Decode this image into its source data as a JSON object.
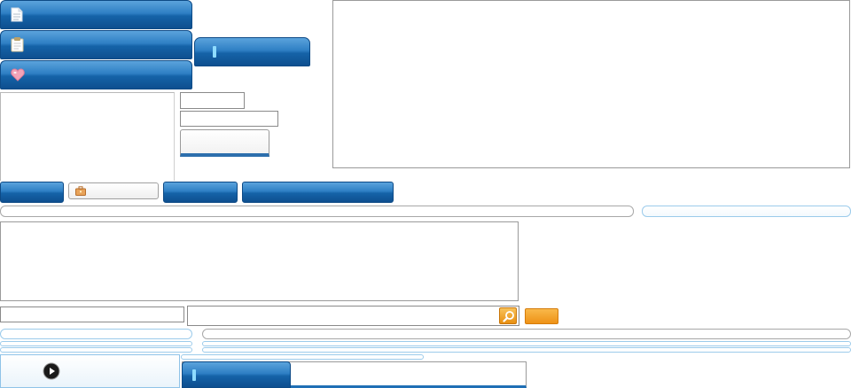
{
  "menu": {
    "items": [
      {
        "icon": "document-icon",
        "label": ""
      },
      {
        "icon": "clipboard-icon",
        "label": ""
      },
      {
        "icon": "heart-icon",
        "label": ""
      }
    ]
  },
  "side_tab": {
    "label": ""
  },
  "form": {
    "field_small_value": "",
    "field_medium_value": "",
    "button_label": ""
  },
  "toolbar": {
    "btn1_label": "",
    "briefcase_btn_label": "",
    "btn3_label": "",
    "btn4_label": ""
  },
  "search": {
    "left_field_value": "",
    "query_value": "",
    "placeholder": "",
    "go_label": ""
  },
  "player": {
    "label": ""
  },
  "bottom_tabs": {
    "active_label": "",
    "inactive_label": ""
  },
  "colors": {
    "primary_blue": "#1f6fb5",
    "accent_orange": "#f0a020",
    "border_gray": "#9a9a9a",
    "light_blue_border": "#9ccbeb"
  }
}
